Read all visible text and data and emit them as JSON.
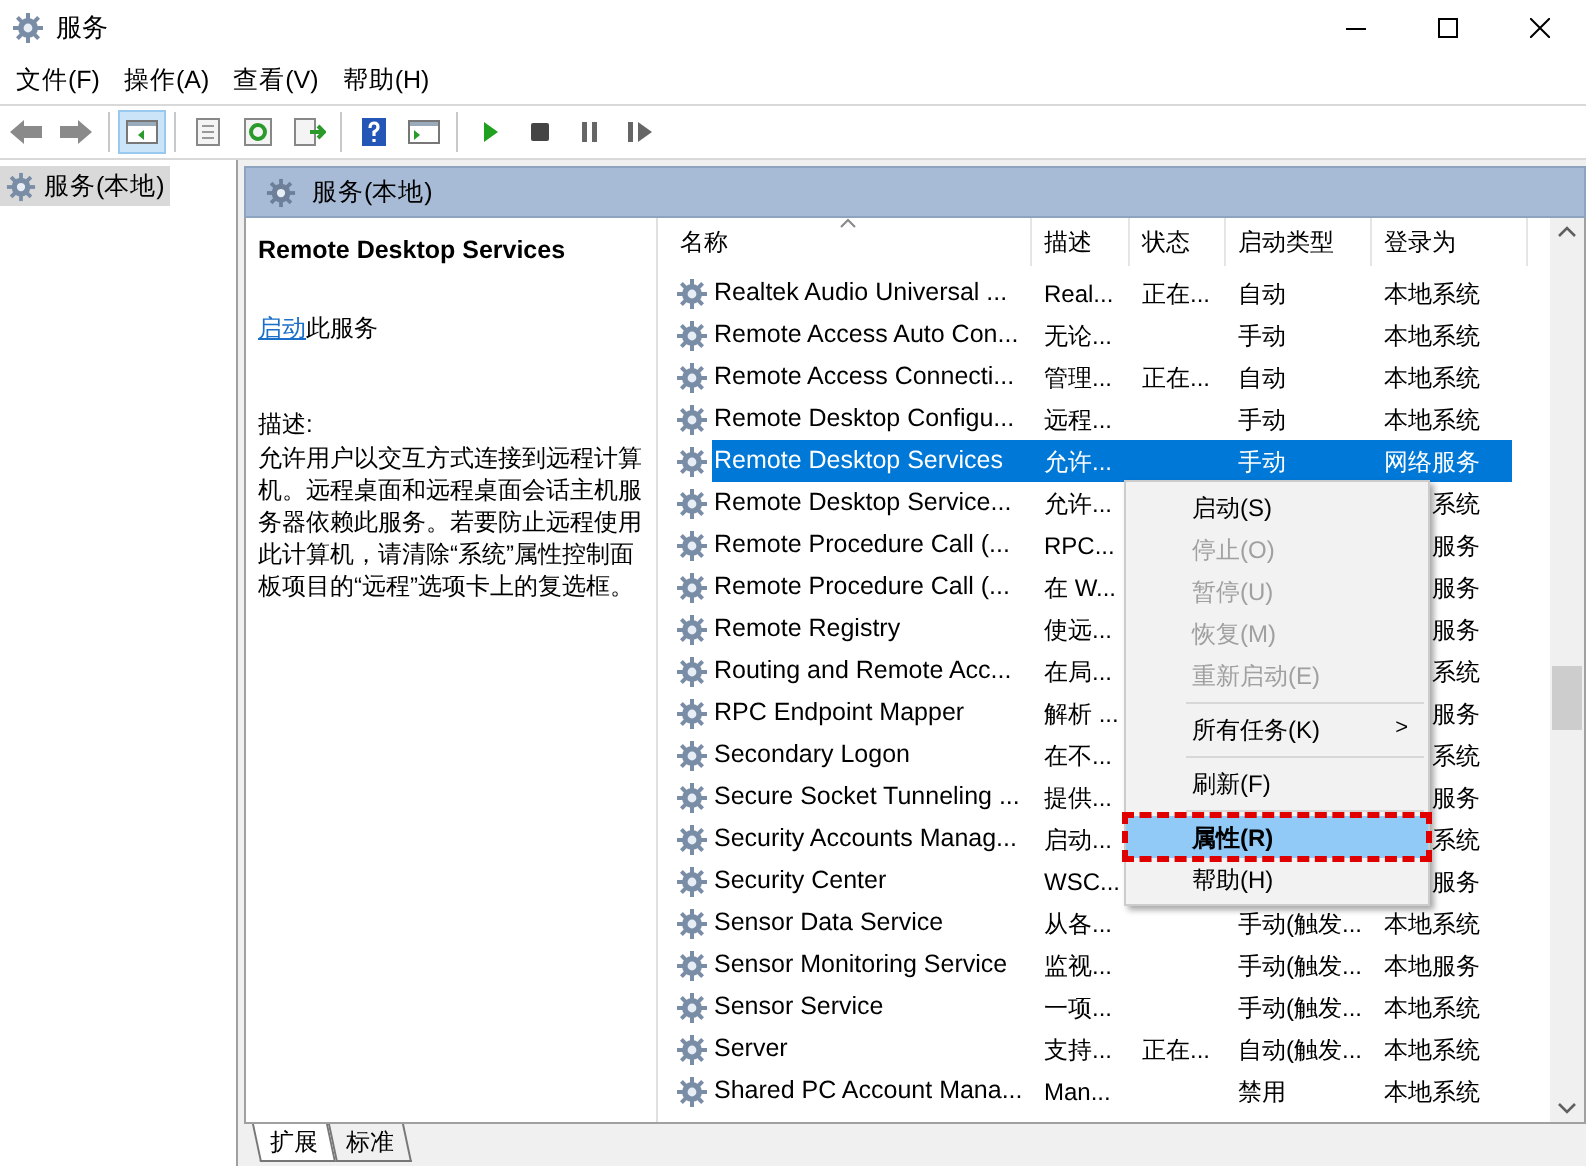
{
  "window": {
    "title": "服务"
  },
  "menu_bar": [
    "文件(F)",
    "操作(A)",
    "查看(V)",
    "帮助(H)"
  ],
  "toolbar": [
    {
      "kind": "back"
    },
    {
      "kind": "forward"
    },
    {
      "kind": "sep"
    },
    {
      "kind": "tree",
      "selected": true
    },
    {
      "kind": "sep"
    },
    {
      "kind": "export"
    },
    {
      "kind": "refresh"
    },
    {
      "kind": "list"
    },
    {
      "kind": "sep"
    },
    {
      "kind": "help"
    },
    {
      "kind": "pane"
    },
    {
      "kind": "sep"
    },
    {
      "kind": "play"
    },
    {
      "kind": "stop"
    },
    {
      "kind": "pause"
    },
    {
      "kind": "resume"
    }
  ],
  "tree": [
    {
      "label": "服务(本地)",
      "selected": true
    }
  ],
  "pane_header": "服务(本地)",
  "details": {
    "title": "Remote Desktop Services",
    "action_link": "启动",
    "action_text": "此服务",
    "description_label": "描述:",
    "description": "允许用户以交互方式连接到远程计算机。远程桌面和远程桌面会话主机服务器依赖此服务。若要防止远程使用此计算机，请清除“系统”属性控制面板项目的“远程”选项卡上的复选框。"
  },
  "table": {
    "columns": [
      "名称",
      "描述",
      "状态",
      "启动类型",
      "登录为"
    ],
    "rows": [
      {
        "name": "Realtek Audio Universal ...",
        "description": "Real...",
        "status": "正在...",
        "startup_type": "自动",
        "log_on_as": "本地系统",
        "selected": false
      },
      {
        "name": "Remote Access Auto Con...",
        "description": "无论...",
        "startup_type": "手动",
        "log_on_as": "本地系统",
        "selected": false
      },
      {
        "name": "Remote Access Connecti...",
        "description": "管理...",
        "status": "正在...",
        "startup_type": "自动",
        "log_on_as": "本地系统",
        "selected": false
      },
      {
        "name": "Remote Desktop Configu...",
        "description": "远程...",
        "startup_type": "手动",
        "log_on_as": "本地系统",
        "selected": false
      },
      {
        "name": "Remote Desktop Services",
        "description": "允许...",
        "startup_type": "手动",
        "log_on_as": "网络服务",
        "selected": true
      },
      {
        "name": "Remote Desktop Service...",
        "description": "允许...",
        "log_on_as": "系统",
        "covered": true,
        "selected": false
      },
      {
        "name": "Remote Procedure Call (...",
        "description": "RPC...",
        "log_on_as": "服务",
        "covered": true,
        "selected": false
      },
      {
        "name": "Remote Procedure Call (...",
        "description": "在 W...",
        "log_on_as": "服务",
        "covered": true,
        "selected": false
      },
      {
        "name": "Remote Registry",
        "description": "使远...",
        "log_on_as": "服务",
        "covered": true,
        "selected": false
      },
      {
        "name": "Routing and Remote Acc...",
        "description": "在局...",
        "log_on_as": "系统",
        "covered": true,
        "selected": false
      },
      {
        "name": "RPC Endpoint Mapper",
        "description": "解析 ...",
        "log_on_as": "服务",
        "covered": true,
        "selected": false
      },
      {
        "name": "Secondary Logon",
        "description": "在不...",
        "log_on_as": "系统",
        "covered": true,
        "selected": false
      },
      {
        "name": "Secure Socket Tunneling ...",
        "description": "提供...",
        "log_on_as": "服务",
        "covered": true,
        "selected": false
      },
      {
        "name": "Security Accounts Manag...",
        "description": "启动...",
        "log_on_as": "系统",
        "covered": true,
        "selected": false
      },
      {
        "name": "Security Center",
        "description": "WSC...",
        "log_on_as": "服务",
        "covered": true,
        "selected": false
      },
      {
        "name": "Sensor Data Service",
        "description": "从各...",
        "startup_type": "手动(触发...",
        "log_on_as": "本地系统",
        "selected": false
      },
      {
        "name": "Sensor Monitoring Service",
        "description": "监视...",
        "startup_type": "手动(触发...",
        "log_on_as": "本地服务",
        "selected": false
      },
      {
        "name": "Sensor Service",
        "description": "一项...",
        "startup_type": "手动(触发...",
        "log_on_as": "本地系统",
        "selected": false
      },
      {
        "name": "Server",
        "description": "支持...",
        "status": "正在...",
        "startup_type": "自动(触发...",
        "log_on_as": "本地系统",
        "selected": false
      },
      {
        "name": "Shared PC Account Mana...",
        "description": "Man...",
        "startup_type": "禁用",
        "log_on_as": "本地系统",
        "selected": false
      }
    ]
  },
  "context_menu": [
    {
      "kind": "item",
      "label": "启动(S)",
      "disabled": false,
      "selected": false
    },
    {
      "kind": "item",
      "label": "停止(O)",
      "disabled": true,
      "selected": false
    },
    {
      "kind": "item",
      "label": "暂停(U)",
      "disabled": true,
      "selected": false
    },
    {
      "kind": "item",
      "label": "恢复(M)",
      "disabled": true,
      "selected": false
    },
    {
      "kind": "item",
      "label": "重新启动(E)",
      "disabled": true,
      "selected": false
    },
    {
      "kind": "separator"
    },
    {
      "kind": "item",
      "label": "所有任务(K)",
      "disabled": false,
      "selected": false,
      "submenu": true,
      "submenu_arrow": ">"
    },
    {
      "kind": "separator"
    },
    {
      "kind": "item",
      "label": "刷新(F)",
      "disabled": false,
      "selected": false
    },
    {
      "kind": "separator"
    },
    {
      "kind": "item",
      "label": "属性(R)",
      "disabled": false,
      "selected": true
    },
    {
      "kind": "item",
      "label": "帮助(H)",
      "disabled": false,
      "selected": false
    }
  ],
  "bottom_tabs": [
    {
      "label": "扩展",
      "selected": true
    },
    {
      "label": "标准",
      "selected": false
    }
  ]
}
